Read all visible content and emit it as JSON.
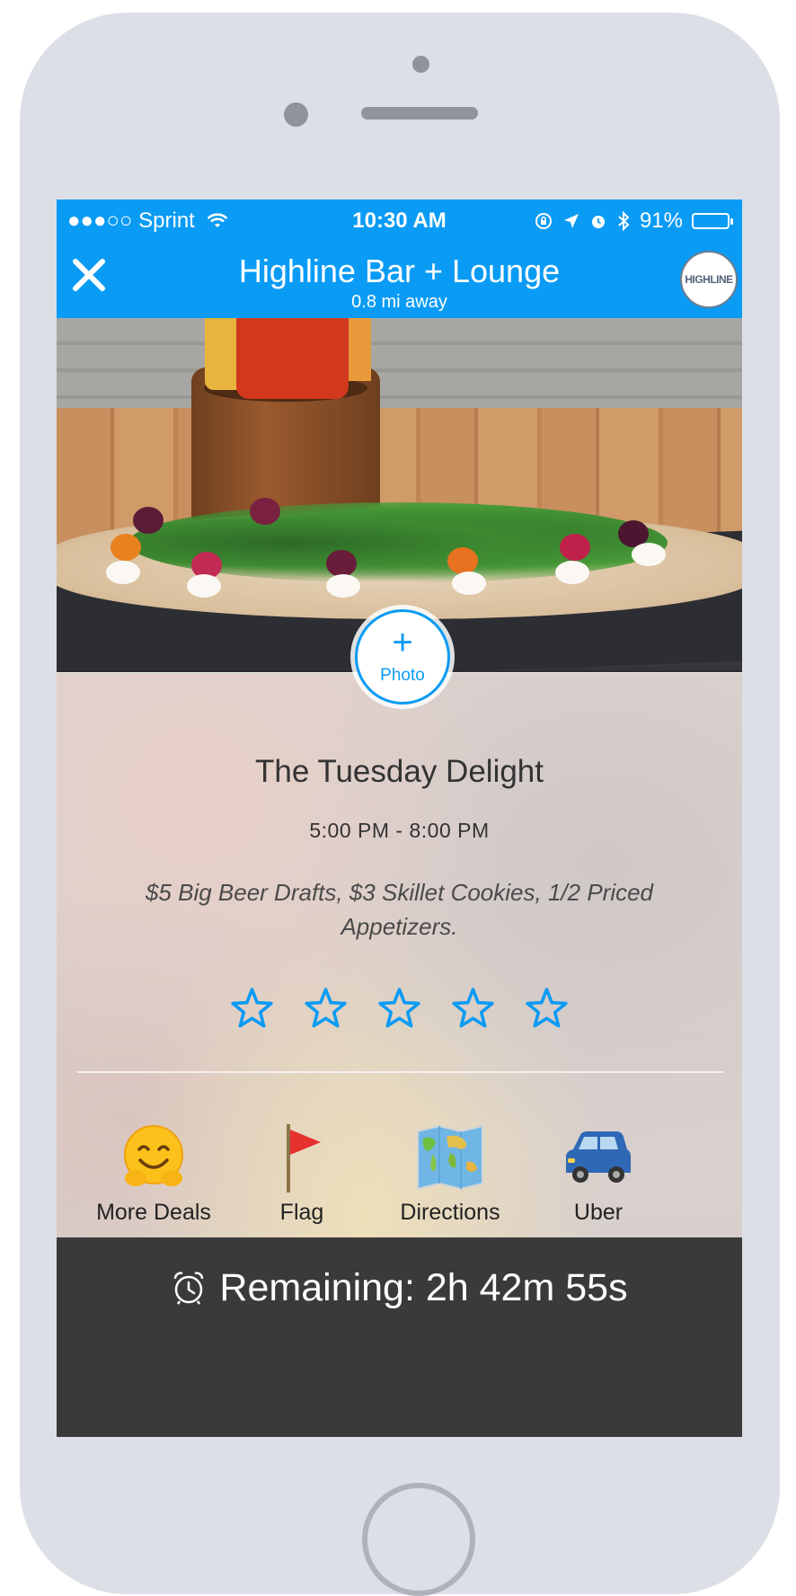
{
  "status_bar": {
    "carrier": "●●●○○ Sprint",
    "time": "10:30 AM",
    "battery": "91%",
    "battery_level": 0.91,
    "icons": [
      "wifi-icon",
      "rotation-lock-icon",
      "location-arrow-icon",
      "alarm-icon",
      "bluetooth-icon",
      "battery-icon"
    ]
  },
  "header": {
    "close_icon": "close-icon",
    "title": "Highline Bar + Lounge",
    "distance": "0.8 mi away",
    "logo_text": "HIGHLINE"
  },
  "photo": {
    "add_photo_label": "Photo",
    "add_photo_icon": "plus-icon"
  },
  "deal": {
    "title": "The Tuesday Delight",
    "hours": "5:00 PM - 8:00 PM",
    "description": "$5 Big Beer Drafts, $3 Skillet Cookies, 1/2 Priced Appetizers.",
    "rating_max": 5,
    "rating": 0
  },
  "actions": [
    {
      "label": "More Deals",
      "icon": "hugging-face-icon"
    },
    {
      "label": "Flag",
      "icon": "red-flag-icon"
    },
    {
      "label": "Directions",
      "icon": "world-map-icon"
    },
    {
      "label": "Uber",
      "icon": "car-icon"
    }
  ],
  "countdown": {
    "icon": "alarm-clock-icon",
    "text": "Remaining: 2h 42m 55s"
  },
  "colors": {
    "accent": "#0a9bf5",
    "countdown_bg": "#3a3a3a",
    "phone_frame": "#dcdfe6"
  }
}
